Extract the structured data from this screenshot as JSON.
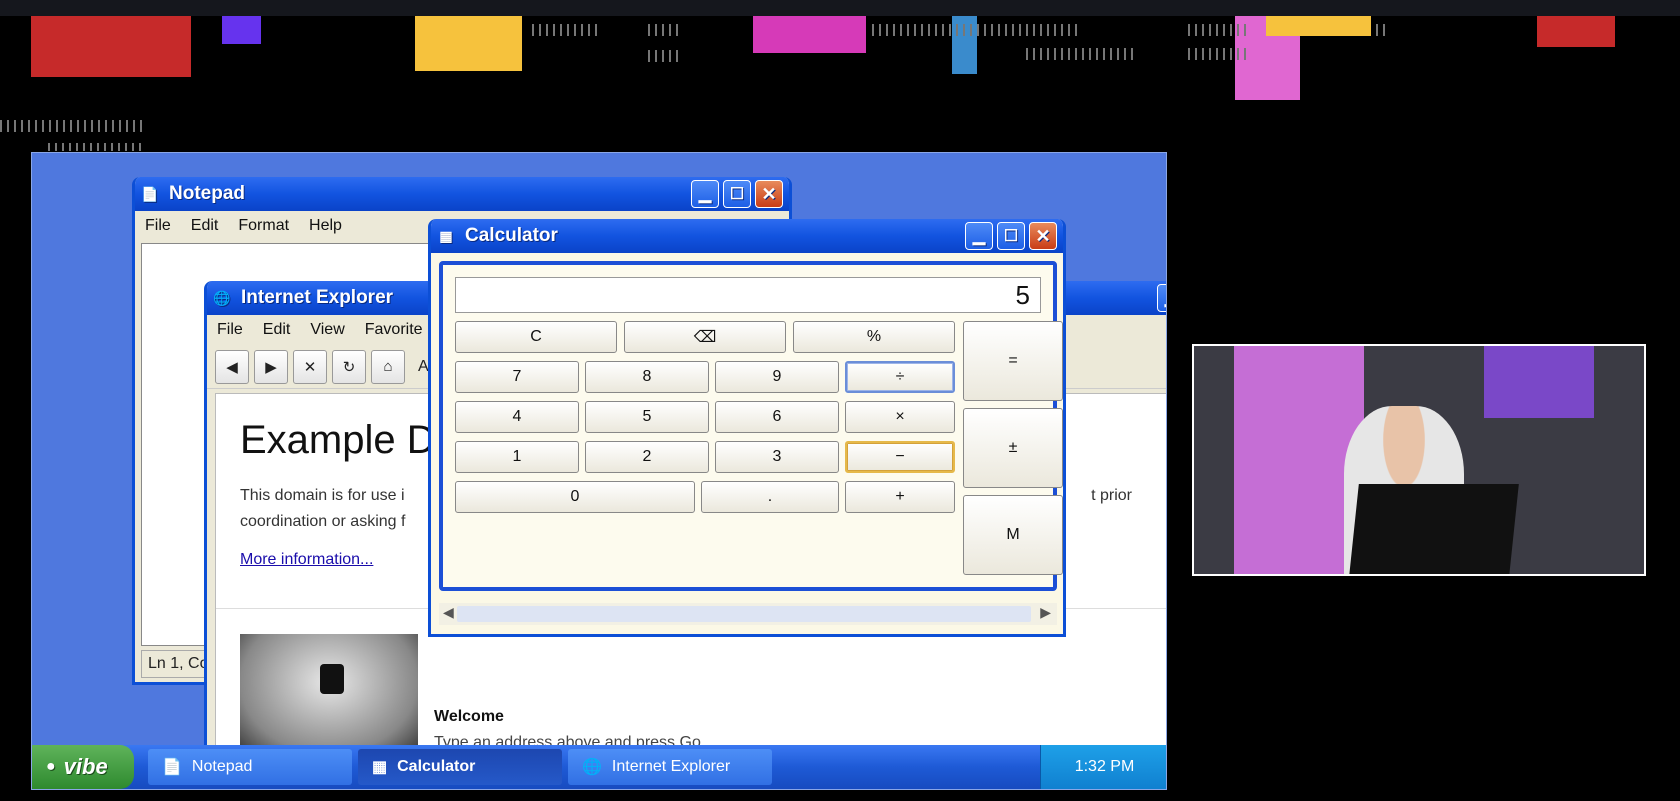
{
  "notepad": {
    "title": "Notepad",
    "menu": [
      "File",
      "Edit",
      "Format",
      "Help"
    ],
    "status": "Ln 1, Co"
  },
  "ie": {
    "title": "Internet Explorer",
    "menu": [
      "File",
      "Edit",
      "View",
      "Favorite"
    ],
    "address_label": "A",
    "heading": "Example D",
    "paragraph_line1": "This domain is for use i",
    "paragraph_line1_end": "t prior",
    "paragraph_line2": "coordination or asking f",
    "link": "More information...",
    "welcome": "Welcome",
    "hint": "Type an address above and press Go."
  },
  "calculator": {
    "title": "Calculator",
    "display": "5",
    "keys": {
      "c": "C",
      "back": "⌫",
      "pct": "%",
      "eq": "=",
      "k7": "7",
      "k8": "8",
      "k9": "9",
      "div": "÷",
      "k4": "4",
      "k5": "5",
      "k6": "6",
      "mul": "×",
      "k1": "1",
      "k2": "2",
      "k3": "3",
      "sub": "−",
      "k0": "0",
      "dot": ".",
      "add": "+",
      "pm": "±",
      "m": "M"
    }
  },
  "taskbar": {
    "start": "vibe",
    "tasks": [
      "Notepad",
      "Calculator",
      "Internet Explorer"
    ],
    "clock": "1:32 PM"
  },
  "colors": {
    "accent": "#1254e0",
    "desktop": "#4f78de",
    "start": "#2e8a2e"
  }
}
